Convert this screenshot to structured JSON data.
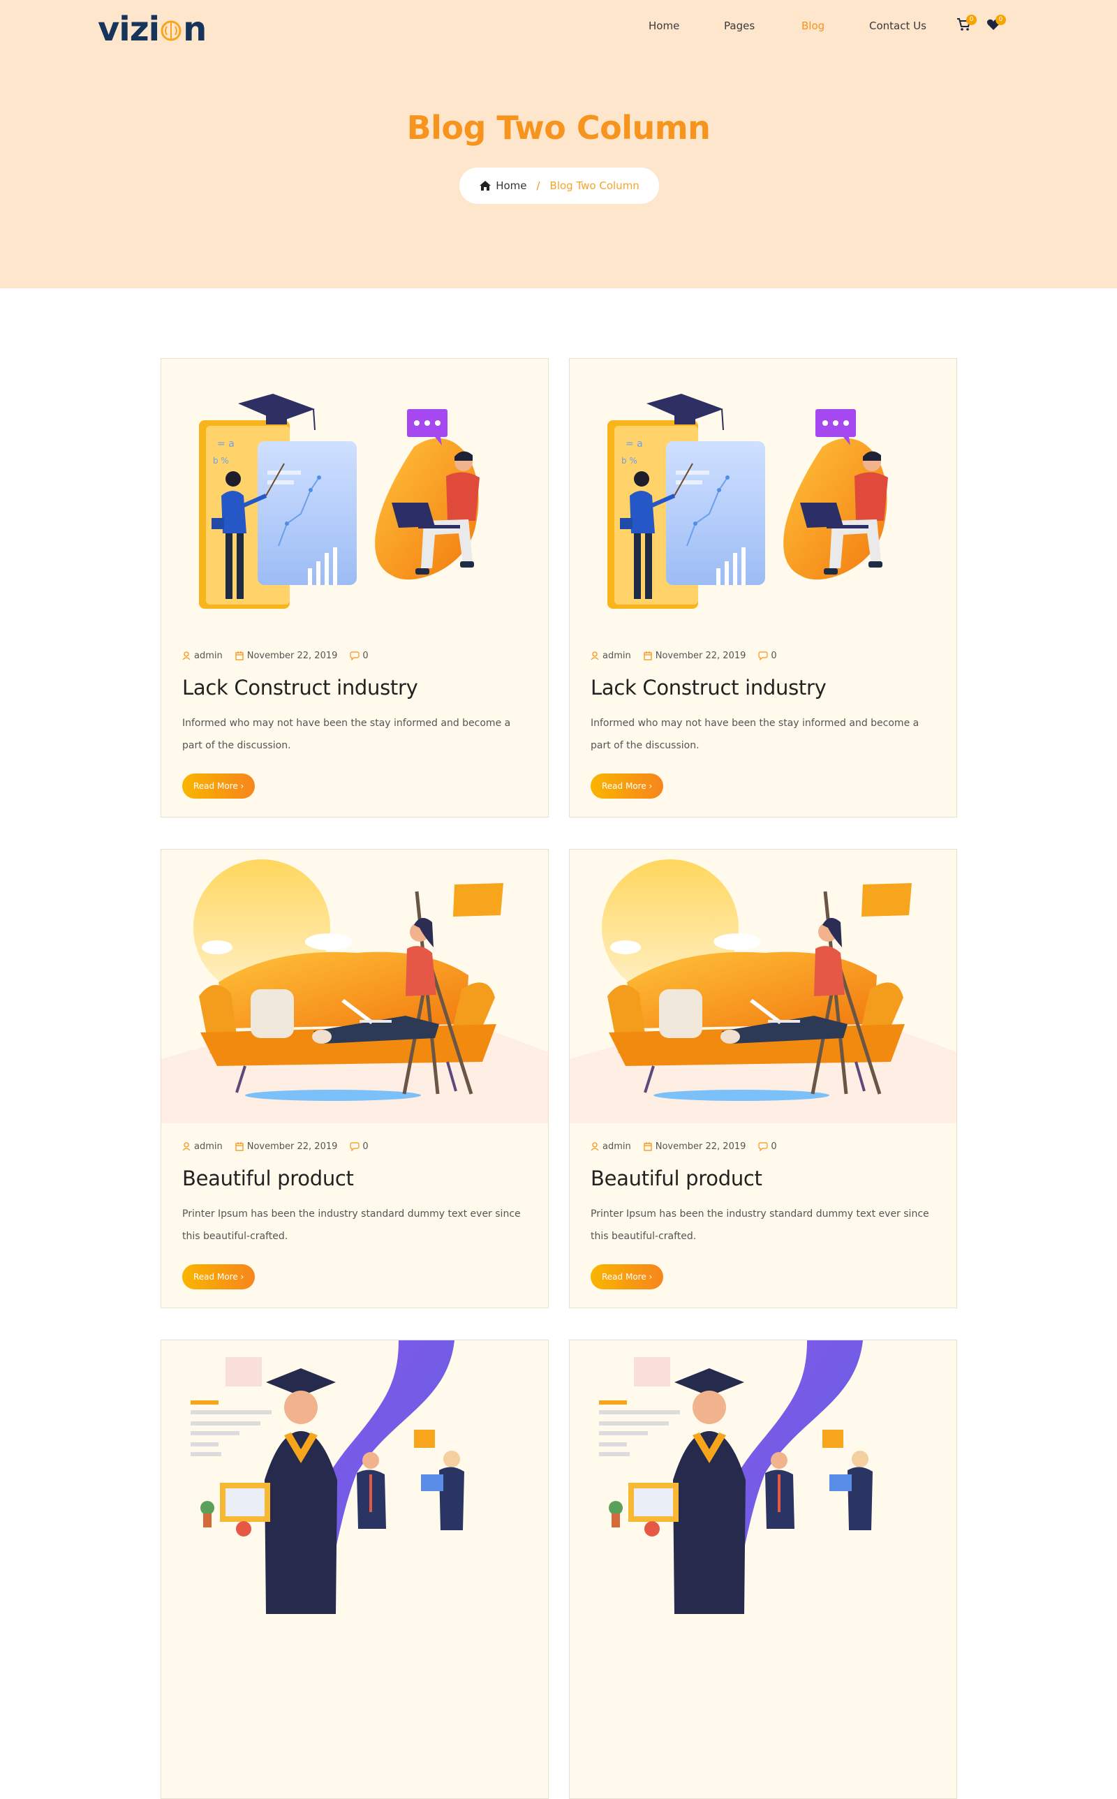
{
  "header": {
    "logo": {
      "pre": "vizi",
      "post": "n"
    },
    "nav": [
      "Home",
      "Pages",
      "Blog",
      "Contact Us"
    ],
    "active_nav": "Blog",
    "cart_count": "0",
    "wishlist_count": "0"
  },
  "hero": {
    "title": "Blog Two Column",
    "breadcrumb": {
      "home": "Home",
      "separator": "/",
      "current": "Blog Two Column"
    }
  },
  "posts": [
    {
      "author": "admin",
      "date": "November 22, 2019",
      "comments": "0",
      "title": "Lack Construct industry",
      "excerpt": "Informed who may not have been the stay informed and become a part of the discussion.",
      "button": "Read More",
      "image": "education-illustration"
    },
    {
      "author": "admin",
      "date": "November 22, 2019",
      "comments": "0",
      "title": "Lack Construct industry",
      "excerpt": "Informed who may not have been the stay informed and become a part of the discussion.",
      "button": "Read More",
      "image": "education-illustration"
    },
    {
      "author": "admin",
      "date": "November 22, 2019",
      "comments": "0",
      "title": "Beautiful product",
      "excerpt": "Printer Ipsum has been the industry standard dummy text ever since this beautiful-crafted.",
      "button": "Read More",
      "image": "sofa-laptop-illustration"
    },
    {
      "author": "admin",
      "date": "November 22, 2019",
      "comments": "0",
      "title": "Beautiful product",
      "excerpt": "Printer Ipsum has been the industry standard dummy text ever since this beautiful-crafted.",
      "button": "Read More",
      "image": "sofa-laptop-illustration"
    },
    {
      "image": "graduation-team-illustration"
    },
    {
      "image": "graduation-team-illustration"
    }
  ],
  "colors": {
    "accent": "#f7941d",
    "hero_bg": "#fde6cc",
    "card_bg": "#fffaeb",
    "logo": "#17345a"
  }
}
